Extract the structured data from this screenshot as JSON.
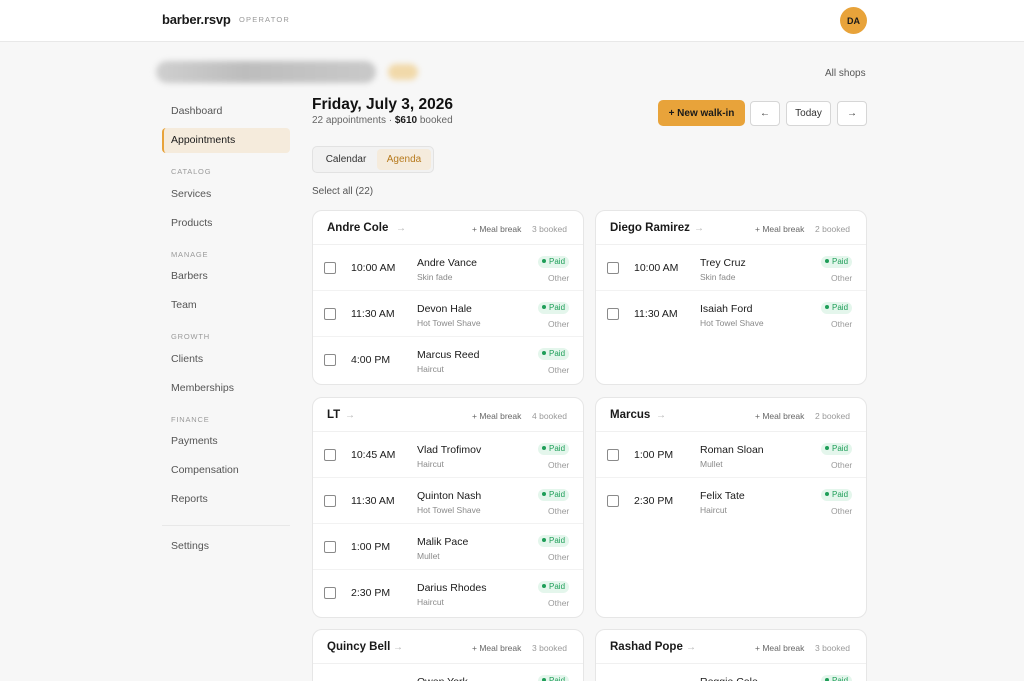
{
  "header": {
    "logo": "barber.rsvp",
    "logo_sub": "OPERATOR",
    "avatar": "DA"
  },
  "shop_bar": {
    "all_shops": "All shops"
  },
  "sidebar": {
    "items": {
      "dashboard": "Dashboard",
      "appointments": "Appointments",
      "services": "Services",
      "products": "Products",
      "barbers": "Barbers",
      "team": "Team",
      "clients": "Clients",
      "memberships": "Memberships",
      "payments": "Payments",
      "compensation": "Compensation",
      "reports": "Reports",
      "settings": "Settings"
    },
    "sections": {
      "catalog": "CATALOG",
      "manage": "MANAGE",
      "growth": "GROWTH",
      "finance": "FINANCE"
    }
  },
  "page": {
    "title": "Friday, July 3, 2026",
    "appointments_count": "22 appointments",
    "separator": " · ",
    "booked_amount": "$610",
    "booked_label": " booked",
    "new_walkin": "+ New walk-in",
    "prev": "←",
    "today": "Today",
    "next": "→"
  },
  "view_toggle": {
    "calendar": "Calendar",
    "agenda": "Agenda",
    "active": "Agenda"
  },
  "select_all": "Select all (22)",
  "labels": {
    "meal_break": "+ Meal break",
    "paid": "Paid",
    "other": "Other",
    "arrow": "→"
  },
  "barbers": [
    {
      "name": "Andre Cole",
      "booked": "3 booked",
      "appointments": [
        {
          "time": "10:00 AM",
          "client": "Andre Vance",
          "service": "Skin fade"
        },
        {
          "time": "11:30 AM",
          "client": "Devon Hale",
          "service": "Hot Towel Shave"
        },
        {
          "time": "4:00 PM",
          "client": "Marcus Reed",
          "service": "Haircut"
        }
      ]
    },
    {
      "name": "Diego Ramirez",
      "booked": "2 booked",
      "appointments": [
        {
          "time": "10:00 AM",
          "client": "Trey Cruz",
          "service": "Skin fade"
        },
        {
          "time": "11:30 AM",
          "client": "Isaiah Ford",
          "service": "Hot Towel Shave"
        }
      ]
    },
    {
      "name": "LT",
      "booked": "4 booked",
      "appointments": [
        {
          "time": "10:45 AM",
          "client": "Vlad Trofimov",
          "service": "Haircut"
        },
        {
          "time": "11:30 AM",
          "client": "Quinton Nash",
          "service": "Hot Towel Shave"
        },
        {
          "time": "1:00 PM",
          "client": "Malik Pace",
          "service": "Mullet"
        },
        {
          "time": "2:30 PM",
          "client": "Darius Rhodes",
          "service": "Haircut"
        }
      ]
    },
    {
      "name": "Marcus",
      "booked": "2 booked",
      "appointments": [
        {
          "time": "1:00 PM",
          "client": "Roman Sloan",
          "service": "Mullet"
        },
        {
          "time": "2:30 PM",
          "client": "Felix Tate",
          "service": "Haircut"
        }
      ]
    },
    {
      "name": "Quincy Bell",
      "booked": "3 booked",
      "appointments": [
        {
          "time": "",
          "client": "Owen York",
          "service": ""
        }
      ]
    },
    {
      "name": "Rashad Pope",
      "booked": "3 booked",
      "appointments": [
        {
          "time": "",
          "client": "Reggie Cole",
          "service": ""
        }
      ]
    }
  ],
  "colors": {
    "accent": "#e8a33a",
    "accent_soft": "#f5ebdc",
    "paid_green": "#1e9e58",
    "paid_bg": "#e4f6ec"
  }
}
